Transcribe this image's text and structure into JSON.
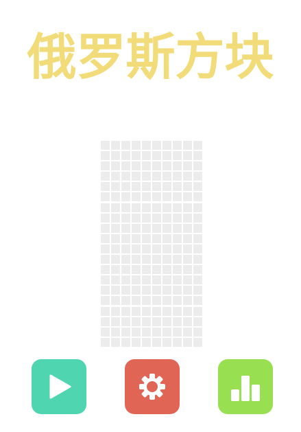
{
  "title": "俄罗斯方块",
  "colors": {
    "title": "#f2dc7a",
    "empty_cell": "#ececec",
    "play_button": "#4fd6b0",
    "settings_button": "#e06555",
    "rank_button": "#98e052",
    "icon": "#ffffff"
  },
  "board": {
    "columns": 10,
    "rows": 20,
    "filled_cells": []
  },
  "buttons": [
    {
      "id": "play",
      "icon": "play-icon"
    },
    {
      "id": "settings",
      "icon": "gear-icon"
    },
    {
      "id": "rank",
      "icon": "bar-chart-icon"
    }
  ]
}
